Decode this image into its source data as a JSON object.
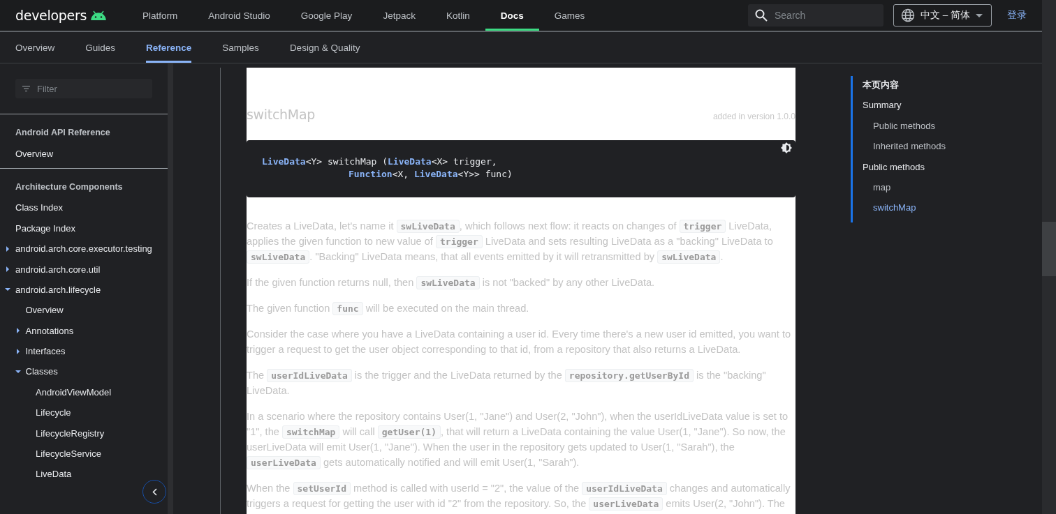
{
  "header": {
    "logo": "developers",
    "nav": [
      {
        "label": "Platform",
        "selected": false
      },
      {
        "label": "Android Studio",
        "selected": false
      },
      {
        "label": "Google Play",
        "selected": false
      },
      {
        "label": "Jetpack",
        "selected": false
      },
      {
        "label": "Kotlin",
        "selected": false
      },
      {
        "label": "Docs",
        "selected": true
      },
      {
        "label": "Games",
        "selected": false
      }
    ],
    "search": {
      "placeholder": "Search"
    },
    "language": "中文 – 简体",
    "sign_in": "登录"
  },
  "tabs": [
    {
      "label": "Overview",
      "selected": false
    },
    {
      "label": "Guides",
      "selected": false
    },
    {
      "label": "Reference",
      "selected": true
    },
    {
      "label": "Samples",
      "selected": false
    },
    {
      "label": "Design & Quality",
      "selected": false
    }
  ],
  "sidebar": {
    "filter": {
      "placeholder": "Filter"
    },
    "sections": [
      {
        "heading": "Android API Reference",
        "items": [
          {
            "label": "Overview"
          }
        ]
      },
      {
        "heading": "Architecture Components",
        "items": [
          {
            "label": "Class Index"
          },
          {
            "label": "Package Index"
          },
          {
            "label": "android.arch.core.executor.testing",
            "expanded": false
          },
          {
            "label": "android.arch.core.util",
            "expanded": false
          },
          {
            "label": "android.arch.lifecycle",
            "expanded": true,
            "children": [
              {
                "label": "Overview"
              },
              {
                "label": "Annotations",
                "expanded": false
              },
              {
                "label": "Interfaces",
                "expanded": false
              },
              {
                "label": "Classes",
                "expanded": true,
                "children": [
                  {
                    "label": "AndroidViewModel"
                  },
                  {
                    "label": "Lifecycle"
                  },
                  {
                    "label": "LifecycleRegistry"
                  },
                  {
                    "label": "LifecycleService"
                  },
                  {
                    "label": "LiveData"
                  }
                ]
              }
            ]
          }
        ]
      }
    ]
  },
  "article": {
    "title": "switchMap",
    "added": "added in version 1.0.0",
    "code": [
      {
        "indent": false,
        "tokens": [
          {
            "kind": "type",
            "text": "LiveData"
          },
          {
            "kind": "plain",
            "text": "<Y> switchMap ("
          },
          {
            "kind": "type",
            "text": "LiveData"
          },
          {
            "kind": "plain",
            "text": "<X> trigger,"
          }
        ]
      },
      {
        "indent": true,
        "tokens": [
          {
            "kind": "type",
            "text": "Function"
          },
          {
            "kind": "plain",
            "text": "<X, "
          },
          {
            "kind": "type",
            "text": "LiveData"
          },
          {
            "kind": "plain",
            "text": "<Y>> func)"
          }
        ]
      }
    ],
    "paragraphs": [
      [
        {
          "kind": "text",
          "text": "Creates a LiveData, let's name it "
        },
        {
          "kind": "code",
          "text": "swLiveData"
        },
        {
          "kind": "text",
          "text": ", which follows next flow: it reacts on changes of "
        },
        {
          "kind": "code",
          "text": "trigger"
        },
        {
          "kind": "text",
          "text": " LiveData, applies the given function to new value of "
        },
        {
          "kind": "code",
          "text": "trigger"
        },
        {
          "kind": "text",
          "text": " LiveData and sets resulting LiveData as a \"backing\" LiveData to "
        },
        {
          "kind": "code",
          "text": "swLiveData"
        },
        {
          "kind": "text",
          "text": ". \"Backing\" LiveData means, that all events emitted by it will retransmitted by "
        },
        {
          "kind": "code",
          "text": "swLiveData"
        },
        {
          "kind": "text",
          "text": "."
        }
      ],
      [
        {
          "kind": "text",
          "text": "If the given function returns null, then "
        },
        {
          "kind": "code",
          "text": "swLiveData"
        },
        {
          "kind": "text",
          "text": " is not \"backed\" by any other LiveData."
        }
      ],
      [
        {
          "kind": "text",
          "text": "The given function "
        },
        {
          "kind": "code",
          "text": "func"
        },
        {
          "kind": "text",
          "text": " will be executed on the main thread."
        }
      ],
      [
        {
          "kind": "text",
          "text": "Consider the case where you have a LiveData containing a user id. Every time there's a new user id emitted, you want to trigger a request to get the user object corresponding to that id, from a repository that also returns a LiveData."
        }
      ],
      [
        {
          "kind": "text",
          "text": "The "
        },
        {
          "kind": "code",
          "text": "userIdLiveData"
        },
        {
          "kind": "text",
          "text": " is the trigger and the LiveData returned by the "
        },
        {
          "kind": "code",
          "text": "repository.getUserById"
        },
        {
          "kind": "text",
          "text": " is the \"backing\" LiveData."
        }
      ],
      [
        {
          "kind": "text",
          "text": "In a scenario where the repository contains User(1, \"Jane\") and User(2, \"John\"), when the userIdLiveData value is set to \"1\", the "
        },
        {
          "kind": "code",
          "text": "switchMap"
        },
        {
          "kind": "text",
          "text": " will call "
        },
        {
          "kind": "code",
          "text": "getUser(1)"
        },
        {
          "kind": "text",
          "text": ", that will return a LiveData containing the value User(1, \"Jane\"). So now, the userLiveData will emit User(1, \"Jane\"). When the user in the repository gets updated to User(1, \"Sarah\"), the "
        },
        {
          "kind": "code",
          "text": "userLiveData"
        },
        {
          "kind": "text",
          "text": " gets automatically notified and will emit User(1, \"Sarah\")."
        }
      ],
      [
        {
          "kind": "text",
          "text": "When the "
        },
        {
          "kind": "code",
          "text": "setUserId"
        },
        {
          "kind": "text",
          "text": " method is called with userId = \"2\", the value of the "
        },
        {
          "kind": "code",
          "text": "userIdLiveData"
        },
        {
          "kind": "text",
          "text": " changes and automatically triggers a request for getting the user with id \"2\" from the repository. So, the "
        },
        {
          "kind": "code",
          "text": "userLiveData"
        },
        {
          "kind": "text",
          "text": " emits User(2, \"John\"). The"
        }
      ]
    ]
  },
  "toc": {
    "title": "本页内容",
    "items": [
      {
        "label": "Summary",
        "selected": false,
        "children": [
          {
            "label": "Public methods",
            "selected": false
          },
          {
            "label": "Inherited methods",
            "selected": false
          }
        ]
      },
      {
        "label": "Public methods",
        "selected": false,
        "children": [
          {
            "label": "map",
            "selected": false
          },
          {
            "label": "switchMap",
            "selected": true
          }
        ]
      }
    ]
  }
}
